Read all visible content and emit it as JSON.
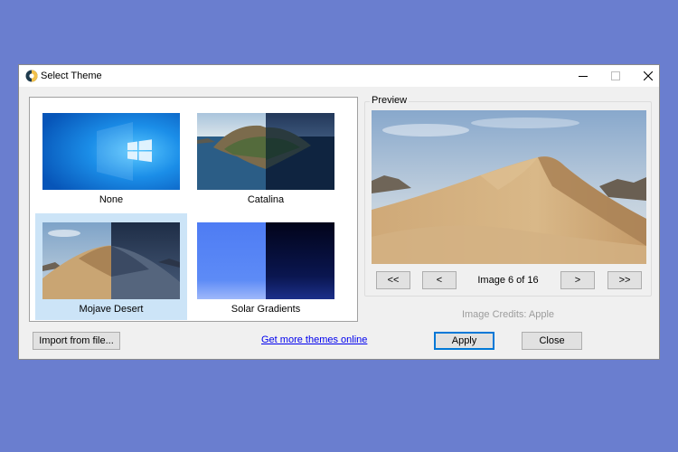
{
  "window": {
    "title": "Select Theme"
  },
  "themes": [
    {
      "label": "None",
      "selected": false
    },
    {
      "label": "Catalina",
      "selected": false
    },
    {
      "label": "Mojave Desert",
      "selected": true
    },
    {
      "label": "Solar Gradients",
      "selected": false
    }
  ],
  "preview": {
    "legend": "Preview",
    "nav": {
      "first": "<<",
      "prev": "<",
      "next": ">",
      "last": ">>"
    },
    "counter": "Image 6 of 16",
    "credits": "Image Credits: Apple"
  },
  "footer": {
    "import_label": "Import from file...",
    "more_link": "Get more themes online",
    "apply_label": "Apply",
    "close_label": "Close"
  },
  "colors": {
    "background": "#6a7ecf",
    "selection": "#cce4f7",
    "link": "#0000ee",
    "default_button_border": "#0078d7"
  }
}
